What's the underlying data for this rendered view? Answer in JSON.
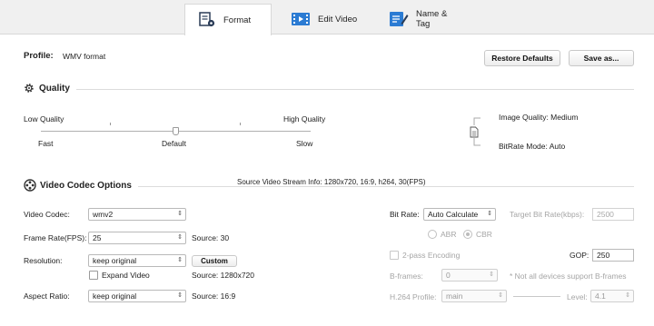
{
  "tabs": [
    {
      "label": "Format",
      "icon": "format-icon",
      "active": true
    },
    {
      "label": "Edit Video",
      "icon": "edit-video-icon",
      "active": false
    },
    {
      "label": "Name & Tag",
      "icon": "name-tag-icon",
      "active": false
    }
  ],
  "profile": {
    "label": "Profile:",
    "value": "WMV format"
  },
  "buttons": {
    "restore": "Restore Defaults",
    "save_as": "Save as...",
    "custom": "Custom"
  },
  "quality": {
    "title": "Quality",
    "low": "Low Quality",
    "high": "High Quality",
    "fast": "Fast",
    "default": "Default",
    "slow": "Slow",
    "level": 0.5,
    "image_quality": "Image Quality: Medium",
    "bitrate_mode": "BitRate Mode: Auto"
  },
  "codec": {
    "title": "Video Codec Options",
    "source_info": "Source Video Stream Info: 1280x720, 16:9, h264, 30(FPS)",
    "video_codec_label": "Video Codec:",
    "video_codec_value": "wmv2",
    "frame_rate_label": "Frame Rate(FPS):",
    "frame_rate_value": "25",
    "frame_rate_source": "Source: 30",
    "resolution_label": "Resolution:",
    "resolution_value": "keep original",
    "resolution_source": "Source: 1280x720",
    "expand_video": "Expand Video",
    "aspect_label": "Aspect Ratio:",
    "aspect_value": "keep original",
    "aspect_source": "Source: 16:9",
    "bitrate_label": "Bit Rate:",
    "bitrate_value": "Auto Calculate",
    "target_bitrate_label": "Target Bit Rate(kbps):",
    "target_bitrate_value": "2500",
    "abr": "ABR",
    "cbr": "CBR",
    "two_pass": "2-pass Encoding",
    "gop_label": "GOP:",
    "gop_value": "250",
    "bframes_label": "B-frames:",
    "bframes_value": "0",
    "bframes_note": "* Not all devices support B-frames",
    "h264_profile_label": "H.264 Profile:",
    "h264_profile_value": "main",
    "level_label": "Level:",
    "level_value": "4.1"
  },
  "colors": {
    "accent": "#2b7bd3",
    "tab_bg": "#f0f0f0"
  }
}
